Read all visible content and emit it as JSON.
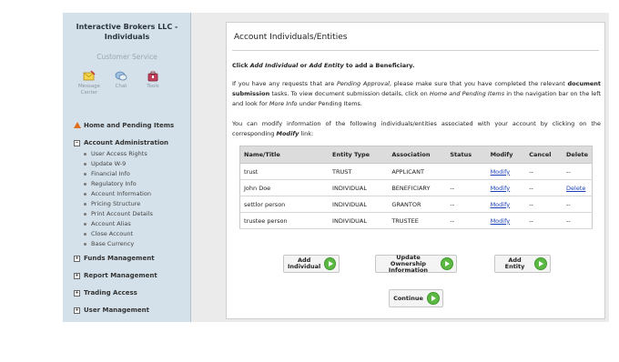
{
  "sidebar": {
    "title_line1": "Interactive Brokers LLC -",
    "title_line2": "Individuals",
    "customer_service": "Customer Service",
    "cs_icons": [
      {
        "label1": "Message",
        "label2": "Center",
        "icon": "message-center-icon"
      },
      {
        "label1": "Chat",
        "label2": "",
        "icon": "chat-icon"
      },
      {
        "label1": "Tools",
        "label2": "",
        "icon": "tools-icon"
      }
    ],
    "home": "Home and Pending Items",
    "account_admin": "Account Administration",
    "account_admin_items": [
      "User Access Rights",
      "Update W-9",
      "Financial Info",
      "Regulatory Info",
      "Account Information",
      "Pricing Structure",
      "Print Account Details",
      "Account Alias",
      "Close Account",
      "Base Currency"
    ],
    "sections": [
      "Funds Management",
      "Report Management",
      "Trading Access",
      "User Management"
    ]
  },
  "content": {
    "title": "Account Individuals/Entities",
    "instr_1": "Click ",
    "instr_2": "Add Individual",
    "instr_3": " or ",
    "instr_4": "Add Entity",
    "instr_5": " to add a Beneficiary.",
    "p2_a": "If you have any requests that are ",
    "p2_b": "Pending Approval",
    "p2_c": ", please make sure that you have completed the relevant ",
    "p2_d": "document submission",
    "p2_e": " tasks. To view document submission details, click on ",
    "p2_f": "Home and Pending Items",
    "p2_g": " in the navigation bar on the left and look for ",
    "p2_h": "More Info",
    "p2_i": " under Pending Items.",
    "p3_a": "You can modify information of the following individuals/entities associated with your account by clicking on the corresponding ",
    "p3_b": "Modify",
    "p3_c": " link:"
  },
  "table": {
    "headers": [
      "Name/Title",
      "Entity Type",
      "Association",
      "Status",
      "Modify",
      "Cancel",
      "Delete"
    ],
    "rows": [
      {
        "name": "trust",
        "type": "TRUST",
        "assoc": "APPLICANT",
        "status": "",
        "modify": "Modify",
        "cancel": "--",
        "delete": "--"
      },
      {
        "name": "John Doe",
        "type": "INDIVIDUAL",
        "assoc": "BENEFICIARY",
        "status": "--",
        "modify": "Modify",
        "cancel": "--",
        "delete": "Delete"
      },
      {
        "name": "settlor person",
        "type": "INDIVIDUAL",
        "assoc": "GRANTOR",
        "status": "--",
        "modify": "Modify",
        "cancel": "--",
        "delete": "--"
      },
      {
        "name": "trustee person",
        "type": "INDIVIDUAL",
        "assoc": "TRUSTEE",
        "status": "--",
        "modify": "Modify",
        "cancel": "--",
        "delete": "--"
      }
    ]
  },
  "buttons": {
    "add_individual_1": "Add",
    "add_individual_2": "Individual",
    "update_ownership_1": "Update Ownership",
    "update_ownership_2": "Information",
    "add_entity": "Add Entity",
    "continue": "Continue"
  },
  "colors": {
    "accent_green": "#5bb843",
    "link_blue": "#1a3fb8",
    "sidebar_bg": "#d4e1ea",
    "warning_orange": "#e07020"
  }
}
